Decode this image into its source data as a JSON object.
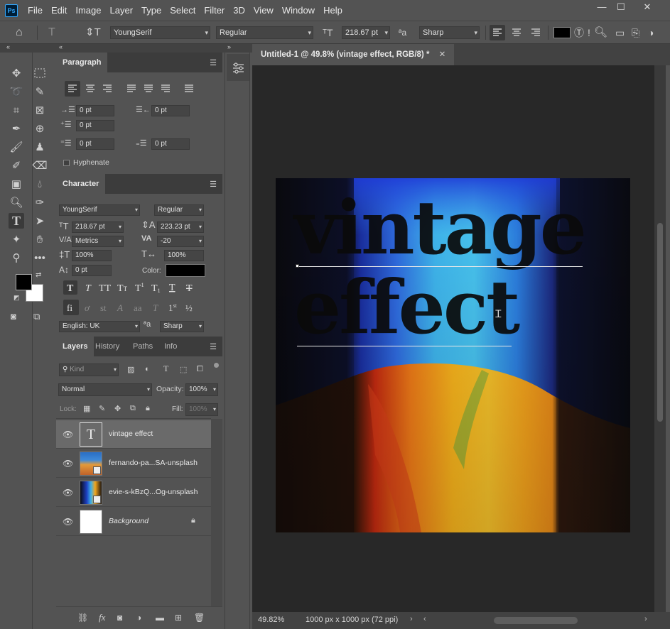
{
  "menu": {
    "logo": "Ps",
    "items": [
      "File",
      "Edit",
      "Image",
      "Layer",
      "Type",
      "Select",
      "Filter",
      "3D",
      "View",
      "Window",
      "Help"
    ]
  },
  "window_controls": {
    "minimize": "—",
    "maximize": "☐",
    "close": "✕"
  },
  "options_bar": {
    "font_family": "YoungSerif",
    "font_style": "Regular",
    "font_size": "218.67 pt",
    "antialias": "Sharp",
    "text_color": "#000000"
  },
  "paragraph_panel": {
    "tab": "Paragraph",
    "indent_left": "0 pt",
    "indent_right": "0 pt",
    "indent_first": "0 pt",
    "space_before": "0 pt",
    "space_after": "0 pt",
    "hyphenate_label": "Hyphenate",
    "hyphenate_checked": false
  },
  "character_panel": {
    "tab": "Character",
    "font_family": "YoungSerif",
    "font_style": "Regular",
    "font_size": "218.67 pt",
    "leading": "223.23 pt",
    "kerning": "Metrics",
    "tracking": "-20",
    "vertical_scale": "100%",
    "horizontal_scale": "100%",
    "baseline_shift": "0 pt",
    "color_label": "Color:",
    "color": "#000000",
    "language": "English: UK",
    "antialias": "Sharp"
  },
  "layers_panel": {
    "tabs": [
      "Layers",
      "History",
      "Paths",
      "Info"
    ],
    "filter_kind": "Kind",
    "blend_mode": "Normal",
    "opacity_label": "Opacity:",
    "opacity": "100%",
    "lock_label": "Lock:",
    "fill_label": "Fill:",
    "fill": "100%",
    "layers": [
      {
        "name": "vintage effect",
        "type": "text",
        "selected": true
      },
      {
        "name": "fernando-pa...SA-unsplash",
        "type": "smart-object",
        "selected": false
      },
      {
        "name": "evie-s-kBzQ...Og-unsplash",
        "type": "smart-object",
        "selected": false
      },
      {
        "name": "Background",
        "type": "background",
        "selected": false,
        "locked": true
      }
    ]
  },
  "document": {
    "tab_title": "Untitled-1 @ 49.8% (vintage effect, RGB/8) *",
    "text_line1": "vintage",
    "text_line2": "effect"
  },
  "status_bar": {
    "zoom": "49.82%",
    "doc_info": "1000 px x 1000 px (72 ppi)"
  },
  "colors": {
    "foreground": "#000000",
    "background": "#ffffff",
    "accent": "#31a8ff"
  }
}
